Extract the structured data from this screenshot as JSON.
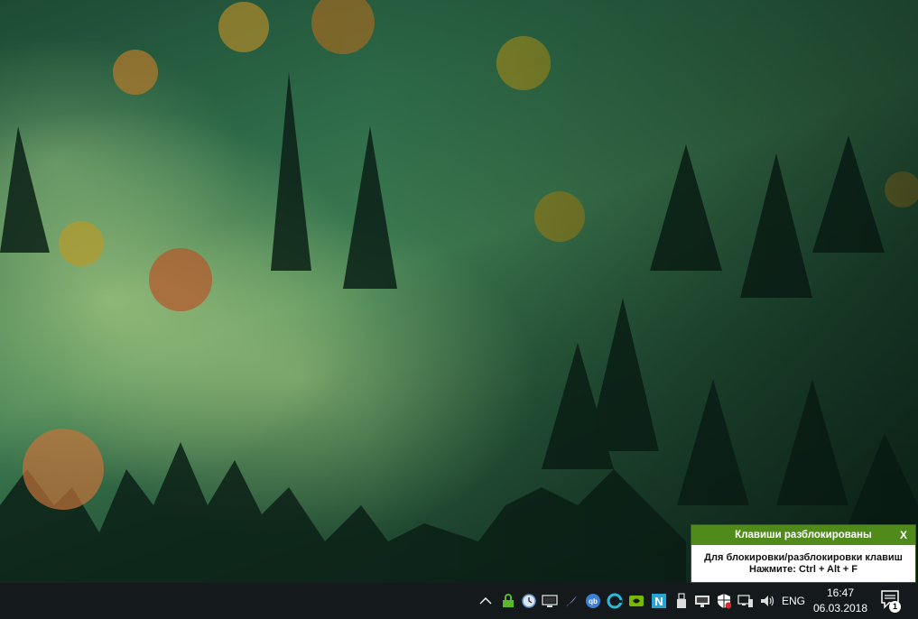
{
  "popup": {
    "title": "Клавиши разблокированы",
    "close_label": "X",
    "line1": "Для блокировки/разблокировки клавиш",
    "line2": "Нажмите: Ctrl + Alt + F",
    "header_color": "#4f8a1a"
  },
  "taskbar": {
    "language": "ENG",
    "time": "16:47",
    "date": "06.03.2018",
    "notification_count": "1",
    "tray_icons": [
      "chevron-up-icon",
      "lock-icon",
      "clock-icon",
      "monitor-icon",
      "feather-icon",
      "qbittorrent-icon",
      "edge-icon",
      "nvidia-icon",
      "n-app-icon",
      "usb-icon",
      "display-icon",
      "security-shield-icon",
      "network-icon",
      "volume-icon"
    ]
  }
}
